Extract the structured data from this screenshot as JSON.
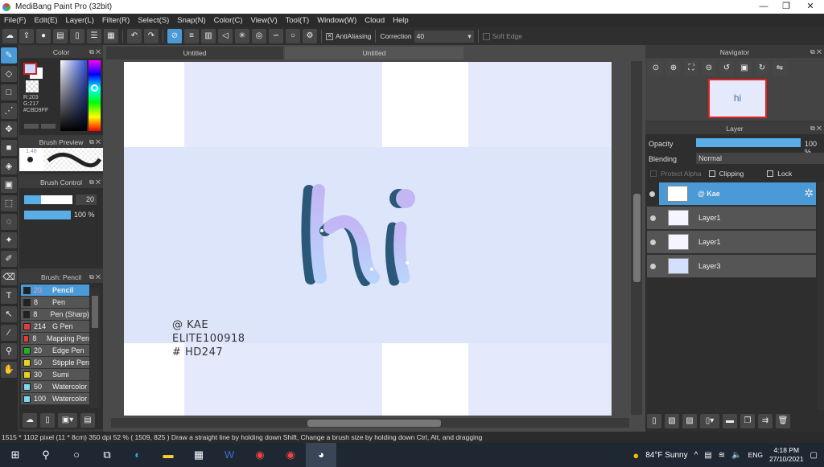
{
  "window": {
    "title": "MediBang Paint Pro (32bit)"
  },
  "menu": [
    "File(F)",
    "Edit(E)",
    "Layer(L)",
    "Filter(R)",
    "Select(S)",
    "Snap(N)",
    "Color(C)",
    "View(V)",
    "Tool(T)",
    "Window(W)",
    "Cloud",
    "Help"
  ],
  "toolbar": {
    "antialiasing_label": "AntiAliasing",
    "antialiasing_checked": true,
    "correction_label": "Correction",
    "correction_value": "40",
    "soft_edge_label": "Soft Edge",
    "soft_edge_checked": false
  },
  "color_panel": {
    "title": "Color",
    "r": "R:203",
    "g": "G:217",
    "hex": "#CBD9FF",
    "fg_color": "#cbd9ff"
  },
  "brush_preview": {
    "title": "Brush Preview",
    "size": "1.48"
  },
  "brush_control": {
    "title": "Brush Control",
    "size": "20",
    "opacity": "100 %",
    "size_fraction": 0.35,
    "opacity_fraction": 1.0
  },
  "brush_list": {
    "title": "Brush: Pencil",
    "items": [
      {
        "size": "20",
        "name": "Pencil",
        "color": "#222222",
        "selected": true
      },
      {
        "size": "8",
        "name": "Pen",
        "color": "#222222"
      },
      {
        "size": "8",
        "name": "Pen (Sharp)",
        "color": "#222222"
      },
      {
        "size": "214",
        "name": "G Pen",
        "color": "#e33b3b"
      },
      {
        "size": "8",
        "name": "Mapping Pen",
        "color": "#e33b3b"
      },
      {
        "size": "20",
        "name": "Edge Pen",
        "color": "#22b022"
      },
      {
        "size": "50",
        "name": "Stipple Pen",
        "color": "#e8d420"
      },
      {
        "size": "30",
        "name": "Sumi",
        "color": "#e8d420"
      },
      {
        "size": "50",
        "name": "Watercolor",
        "color": "#7fd8f0"
      },
      {
        "size": "100",
        "name": "Watercolor",
        "color": "#7fd8f0"
      }
    ]
  },
  "tabs": [
    {
      "label": "Untitled"
    },
    {
      "label": "Untitled",
      "active": true
    }
  ],
  "canvas": {
    "art_text": "hi",
    "watermark": [
      "@ KAE",
      "ELITE100918",
      "# HD247"
    ]
  },
  "navigator": {
    "title": "Navigator"
  },
  "layer_panel": {
    "title": "Layer",
    "opacity_label": "Opacity",
    "opacity_value": "100 %",
    "blending_label": "Blending",
    "blending_value": "Normal",
    "protect_alpha": "Protect Alpha",
    "clipping": "Clipping",
    "lock": "Lock",
    "layers": [
      {
        "name": "@ Kae",
        "selected": true
      },
      {
        "name": "Layer1"
      },
      {
        "name": "Layer1"
      },
      {
        "name": "Layer3"
      }
    ]
  },
  "status": "1515 * 1102 pixel  (11 * 8cm)  350 dpi  52 %  ( 1509, 825 )  Draw a straight line by holding down Shift, Change a brush size by holding down Ctrl, Alt, and dragging",
  "taskbar": {
    "weather": "84°F  Sunny",
    "lang": "ENG",
    "time": "4:18 PM",
    "date": "27/10/2021"
  }
}
